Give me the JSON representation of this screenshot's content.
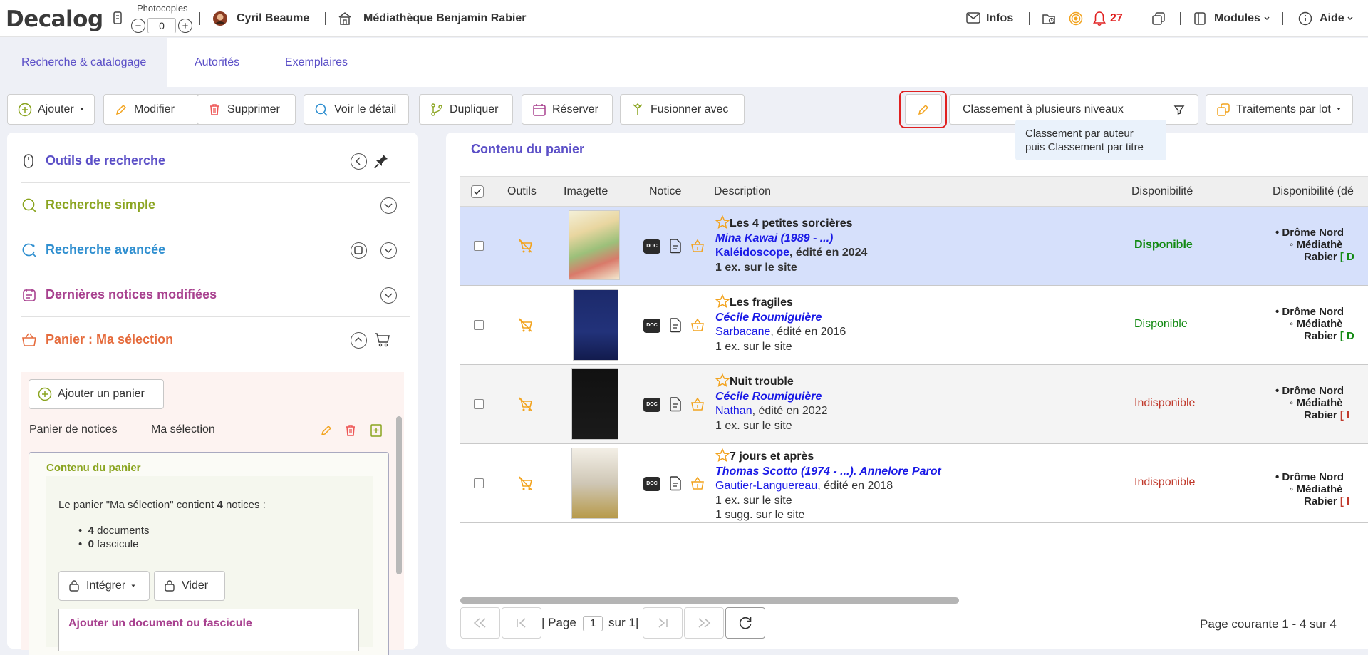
{
  "header": {
    "logo": "Decalog",
    "photocopies_label": "Photocopies",
    "photocopies_value": "0",
    "minus": "−",
    "plus": "+",
    "user": "Cyril Beaume",
    "site": "Médiathèque Benjamin Rabier",
    "infos": "Infos",
    "notif_count": "27",
    "modules": "Modules",
    "aide": "Aide"
  },
  "tabs": [
    {
      "label": "Recherche & catalogage",
      "active": true
    },
    {
      "label": "Autorités"
    },
    {
      "label": "Exemplaires"
    }
  ],
  "toolbar": {
    "ajouter": "Ajouter",
    "modifier": "Modifier",
    "supprimer": "Supprimer",
    "voir_detail": "Voir le détail",
    "dupliquer": "Dupliquer",
    "reserver": "Réserver",
    "fusionner": "Fusionner avec",
    "classement": "Classement à plusieurs niveaux",
    "traitements": "Traitements par lot",
    "tooltip_line1": "Classement par auteur",
    "tooltip_line2": "puis Classement par titre"
  },
  "left": {
    "outils": "Outils de recherche",
    "simple": "Recherche simple",
    "avancee": "Recherche avancée",
    "dernieres": "Dernières notices modifiées",
    "panier": "Panier : Ma sélection",
    "ajouter_panier": "Ajouter un panier",
    "panier_de_notices": "Panier de notices",
    "ma_selection": "Ma sélection",
    "contenu_title": "Contenu du panier",
    "contains_pre": "Le panier \"Ma sélection\" contient ",
    "contains_count": "4",
    "contains_post": " notices :",
    "docs_count": "4",
    "docs_label": " documents",
    "fasc_count": "0",
    "fasc_label": " fascicule",
    "integrer": "Intégrer",
    "vider": "Vider",
    "ajouter_doc": "Ajouter un document ou fascicule"
  },
  "right": {
    "title": "Contenu du panier",
    "columns": [
      "Outils",
      "Imagette",
      "Notice",
      "Description",
      "Disponibilité",
      "Disponibilité (dé"
    ],
    "rows": [
      {
        "title": "Les 4 petites sorcières",
        "author": "Mina Kawai (1989 - ...)",
        "publisher": "Kaléidoscope",
        "edition": ", édité en 2024",
        "ex": "1 ex. sur le site",
        "sugg": "",
        "availability": "Disponible",
        "avail_color": "#138a13",
        "loc1": "Drôme Nord",
        "loc2": "Médiathè",
        "loc3": "Rabier",
        "loc_flag": "[ D",
        "loc_flag_color": "#138a13",
        "selected": true,
        "bold_publisher": true
      },
      {
        "title": "Les fragiles",
        "author": "Cécile Roumiguière",
        "publisher": "Sarbacane",
        "edition": ", édité en 2016",
        "ex": "1 ex. sur le site",
        "sugg": "",
        "availability": "Disponible",
        "avail_color": "#138a13",
        "loc1": "Drôme Nord",
        "loc2": "Médiathè",
        "loc3": "Rabier",
        "loc_flag": "[ D",
        "loc_flag_color": "#138a13"
      },
      {
        "title": "Nuit trouble",
        "author": "Cécile Roumiguière",
        "publisher": "Nathan",
        "edition": ", édité en 2022",
        "ex": "1 ex. sur le site",
        "sugg": "",
        "availability": "Indisponible",
        "avail_color": "#c0392b",
        "loc1": "Drôme Nord",
        "loc2": "Médiathè",
        "loc3": "Rabier",
        "loc_flag": "[ I",
        "loc_flag_color": "#c0392b"
      },
      {
        "title": "7 jours et après",
        "author": "Thomas Scotto (1974 - ...). Annelore Parot",
        "publisher": "Gautier-Languereau",
        "edition": ", édité en 2018",
        "ex": "1 ex. sur le site",
        "sugg": "1 sugg. sur le site",
        "availability": "Indisponible",
        "avail_color": "#c0392b",
        "loc1": "Drôme Nord",
        "loc2": "Médiathè",
        "loc3": "Rabier",
        "loc_flag": "[ I",
        "loc_flag_color": "#c0392b"
      }
    ],
    "pager_page_label": "Page",
    "pager_page": "1",
    "pager_of": "sur 1",
    "pager_summary": "Page courante 1 - 4 sur 4"
  },
  "colors": {
    "accent": "#5b4fc7",
    "green": "#8aa41f",
    "blue": "#2f8fd0",
    "magenta": "#a8418f",
    "orange": "#e56b3c",
    "highlight": "#d6e0fb",
    "tool_orange": "#f2a31e"
  }
}
